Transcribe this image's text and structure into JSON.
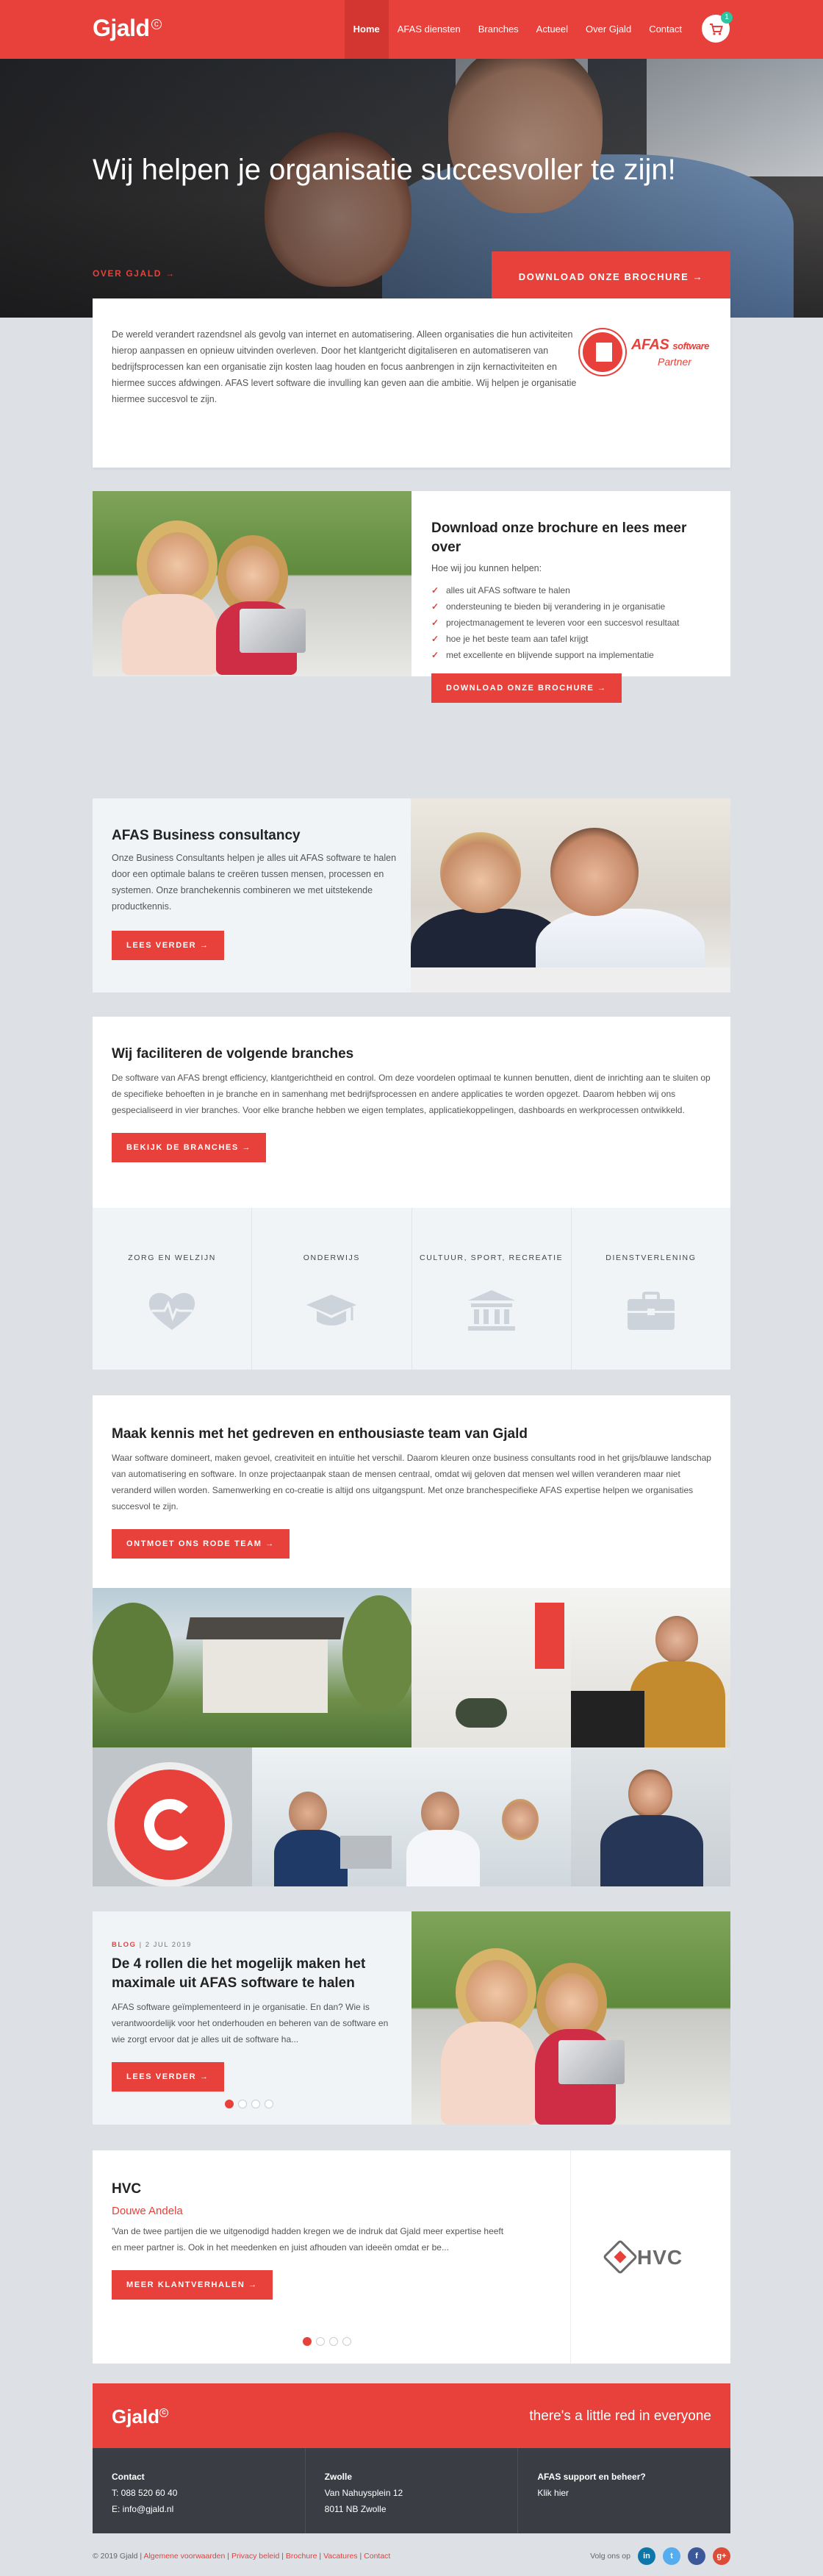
{
  "header": {
    "logo": "Gjald",
    "nav": [
      "Home",
      "AFAS diensten",
      "Branches",
      "Actueel",
      "Over Gjald",
      "Contact"
    ],
    "cart_count": "1"
  },
  "hero": {
    "title": "Wij helpen je organisatie succesvoller te zijn!",
    "over_link": "OVER GJALD",
    "download_button": "DOWNLOAD ONZE BROCHURE"
  },
  "intro": {
    "text": "De wereld verandert razendsnel als gevolg van internet en automatisering. Alleen organisaties die hun activiteiten hierop aanpassen en opnieuw uitvinden overleven. Door het klantgericht digitaliseren en automatiseren van bedrijfsprocessen kan een organisatie zijn kosten laag houden en focus aanbrengen in zijn kernactiviteiten en hiermee succes afdwingen. AFAS levert software die invulling kan geven aan die ambitie. Wij helpen je organisatie hiermee succesvol te zijn.",
    "partner_logo": {
      "brand": "AFAS",
      "suffix": "software",
      "tag": "Partner"
    }
  },
  "brochure": {
    "title": "Download onze brochure en lees meer over",
    "subtitle": "Hoe wij jou kunnen helpen:",
    "items": [
      "alles uit AFAS software te halen",
      "ondersteuning te bieden bij verandering in je organisatie",
      "projectmanagement te leveren voor een succesvol resultaat",
      "hoe je het beste team aan tafel krijgt",
      "met excellente en blijvende support na implementatie"
    ],
    "button": "DOWNLOAD ONZE BROCHURE"
  },
  "consultancy": {
    "title": "AFAS Business consultancy",
    "text": "Onze Business Consultants helpen je alles uit AFAS software te halen door een optimale balans te creëren tussen mensen, processen en systemen. Onze branchekennis combineren we met uitstekende productkennis.",
    "button": "LEES VERDER"
  },
  "branches": {
    "title": "Wij faciliteren de volgende branches",
    "text": "De software van AFAS brengt efficiency, klantgerichtheid en control. Om deze voordelen optimaal te kunnen benutten, dient de inrichting aan te sluiten op de specifieke behoeften in je branche en in samenhang met bedrijfsprocessen en andere applicaties te worden opgezet. Daarom hebben wij ons gespecialiseerd in vier branches. Voor elke branche hebben we eigen templates, applicatiekoppelingen, dashboards en werkprocessen ontwikkeld.",
    "button": "BEKIJK DE BRANCHES",
    "items": [
      {
        "label": "ZORG EN WELZIJN",
        "icon": "heartbeat-icon"
      },
      {
        "label": "ONDERWIJS",
        "icon": "graduation-cap-icon"
      },
      {
        "label": "CULTUUR, SPORT, RECREATIE",
        "icon": "museum-icon"
      },
      {
        "label": "DIENSTVERLENING",
        "icon": "briefcase-icon"
      }
    ]
  },
  "team": {
    "title": "Maak kennis met het gedreven en enthousiaste team van Gjald",
    "text": "Waar software domineert, maken gevoel, creativiteit en intuïtie het verschil. Daarom kleuren onze business consultants rood in het grijs/blauwe landschap van automatisering en software. In onze projectaanpak staan de mensen centraal, omdat wij geloven dat mensen wel willen veranderen maar niet veranderd willen worden. Samenwerking en co-creatie is altijd ons uitgangspunt. Met onze branchespecifieke AFAS expertise helpen we organisaties succesvol te zijn.",
    "button": "ONTMOET ONS RODE TEAM"
  },
  "blog": {
    "category": "BLOG",
    "date": "2 JUL 2019",
    "title": "De 4 rollen die het mogelijk maken het maximale uit AFAS software te halen",
    "text": "AFAS software geïmplementeerd in je organisatie. En dan? Wie is verantwoordelijk voor het onderhouden en beheren van de software en wie zorgt ervoor dat je alles uit de software ha...",
    "button": "LEES VERDER",
    "dots": 4,
    "active_dot": 1
  },
  "testimonial": {
    "title": "HVC",
    "person": "Douwe Andela",
    "text": "'Van de twee partijen die we uitgenodigd hadden kregen we de indruk dat Gjald meer expertise heeft en meer partner is. Ook in het meedenken en juist afhouden van ideeën omdat er be...",
    "button": "MEER KLANTVERHALEN",
    "logo_text": "HVC",
    "dots": 4,
    "active_dot": 1
  },
  "footer": {
    "logo": "Gjald",
    "tagline": "there's a little red in everyone",
    "contact_title": "Contact",
    "phone": "T: 088 520 60 40",
    "email": "E: info@gjald.nl",
    "office_title": "Zwolle",
    "street": "Van Nahuysplein 12",
    "city": "8011 NB Zwolle",
    "support_title": "AFAS support en beheer?",
    "support_link": "Klik hier",
    "copyright": "© 2019 Gjald",
    "links": [
      "Algemene voorwaarden",
      "Privacy beleid",
      "Brochure",
      "Vacatures",
      "Contact"
    ],
    "follow": "Volg ons op",
    "social": [
      {
        "name": "linkedin",
        "label": "in",
        "color": "#0e76a8"
      },
      {
        "name": "twitter",
        "label": "t",
        "color": "#55acee"
      },
      {
        "name": "facebook",
        "label": "f",
        "color": "#3b5998"
      },
      {
        "name": "googleplus",
        "label": "g+",
        "color": "#dd4b39"
      }
    ]
  }
}
